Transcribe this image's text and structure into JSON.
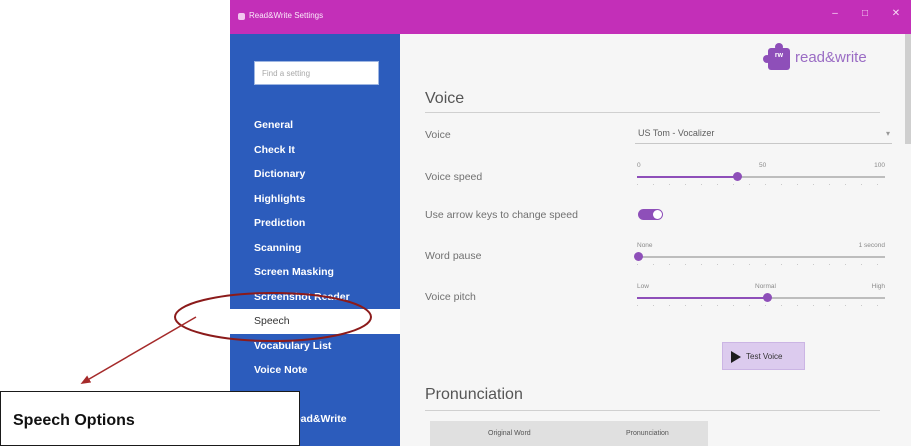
{
  "window": {
    "title": "Read&Write Settings",
    "controls": {
      "minimize": "–",
      "maximize": "□",
      "close": "✕"
    }
  },
  "sidebar": {
    "search_placeholder": "Find a setting",
    "items": [
      {
        "label": "General",
        "active": false
      },
      {
        "label": "Check It",
        "active": false
      },
      {
        "label": "Dictionary",
        "active": false
      },
      {
        "label": "Highlights",
        "active": false
      },
      {
        "label": "Prediction",
        "active": false
      },
      {
        "label": "Scanning",
        "active": false
      },
      {
        "label": "Screen Masking",
        "active": false
      },
      {
        "label": "Screenshot Reader",
        "active": false
      },
      {
        "label": "Speech",
        "active": true
      },
      {
        "label": "Vocabulary List",
        "active": false
      },
      {
        "label": "Voice Note",
        "active": false
      },
      {
        "label": "",
        "active": false
      },
      {
        "label": "About Read&Write",
        "active": false
      }
    ]
  },
  "logo": {
    "mark": "rw",
    "text": "read&write"
  },
  "voice": {
    "heading": "Voice",
    "voice_label": "Voice",
    "voice_value": "US Tom - Vocalizer",
    "speed": {
      "label": "Voice speed",
      "tick_labels": [
        "0",
        "50",
        "100"
      ],
      "value": 0.4
    },
    "arrow_keys": {
      "label": "Use arrow keys to change speed",
      "on": true
    },
    "word_pause": {
      "label": "Word pause",
      "tick_labels": [
        "None",
        "1 second"
      ],
      "value": 0
    },
    "pitch": {
      "label": "Voice pitch",
      "tick_labels": [
        "Low",
        "Normal",
        "High"
      ],
      "value": 0.52
    },
    "test_button": "Test Voice"
  },
  "pronunciation": {
    "heading": "Pronunciation",
    "columns": [
      "Original Word",
      "Pronunciation"
    ]
  },
  "annotation": {
    "callout": "Speech Options",
    "colors": {
      "ellipse": "#8b1a1a",
      "arrow": "#a52a2a"
    }
  },
  "colors": {
    "titlebar": "#c32fb8",
    "sidebar": "#2c5cbc",
    "accent": "#8e4fb9"
  }
}
